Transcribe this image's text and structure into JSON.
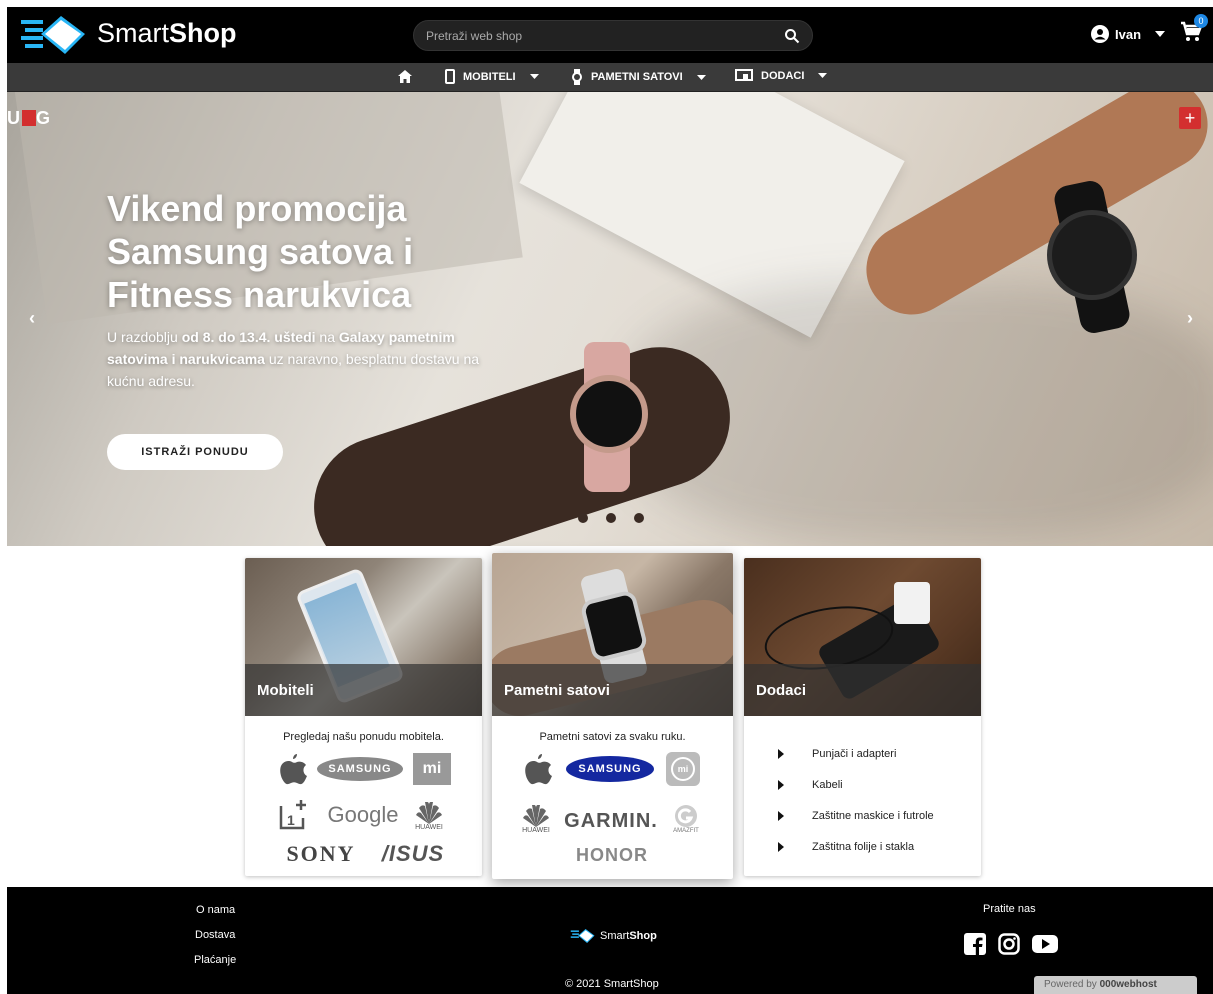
{
  "header": {
    "brand_light": "Smart",
    "brand_bold": "Shop",
    "search_placeholder": "Pretraži web shop",
    "user_name": "Ivan",
    "cart_count": "0"
  },
  "nav": {
    "items": [
      {
        "label": "MOBITELI"
      },
      {
        "label": "PAMETNI SATOVI"
      },
      {
        "label": "DODACI"
      }
    ]
  },
  "hero": {
    "badge_text": "U G",
    "title": "Vikend promocija Samsung satova i Fitness narukvica",
    "text_pre": "U razdoblju ",
    "text_bold1": "od 8. do 13.4. uštedi",
    "text_mid1": " na ",
    "text_bold2": "Galaxy pametnim satovima i narukvicama",
    "text_post": " uz naravno, besplatnu dostavu na kućnu adresu.",
    "cta_label": "ISTRAŽI PONUDU",
    "prev_arrow": "‹",
    "next_arrow": "›",
    "plus_label": "+",
    "slide_count": 3
  },
  "cards": [
    {
      "title": "Mobiteli",
      "description": "Pregledaj našu ponudu mobitela.",
      "brands": [
        "SAMSUNG",
        "mi",
        "Google",
        "HUAWEI",
        "SONY",
        "/ISUS"
      ]
    },
    {
      "title": "Pametni satovi",
      "description": "Pametni satovi za svaku ruku.",
      "brands": [
        "SAMSUNG",
        "mi",
        "HUAWEI",
        "GARMIN.",
        "AMAZFIT",
        "HONOR"
      ]
    },
    {
      "title": "Dodaci",
      "items": [
        "Punjači i adapteri",
        "Kabeli",
        "Zaštitne maskice i futrole",
        "Zaštitna folije i stakla"
      ]
    }
  ],
  "footer": {
    "links": [
      "O nama",
      "Dostava",
      "Plaćanje"
    ],
    "brand_light": "Smart",
    "brand_bold": "Shop",
    "follow_label": "Pratite nas",
    "copyright": "© 2021 SmartShop",
    "powered_label": "Powered by",
    "powered_brand": "000webhost"
  }
}
